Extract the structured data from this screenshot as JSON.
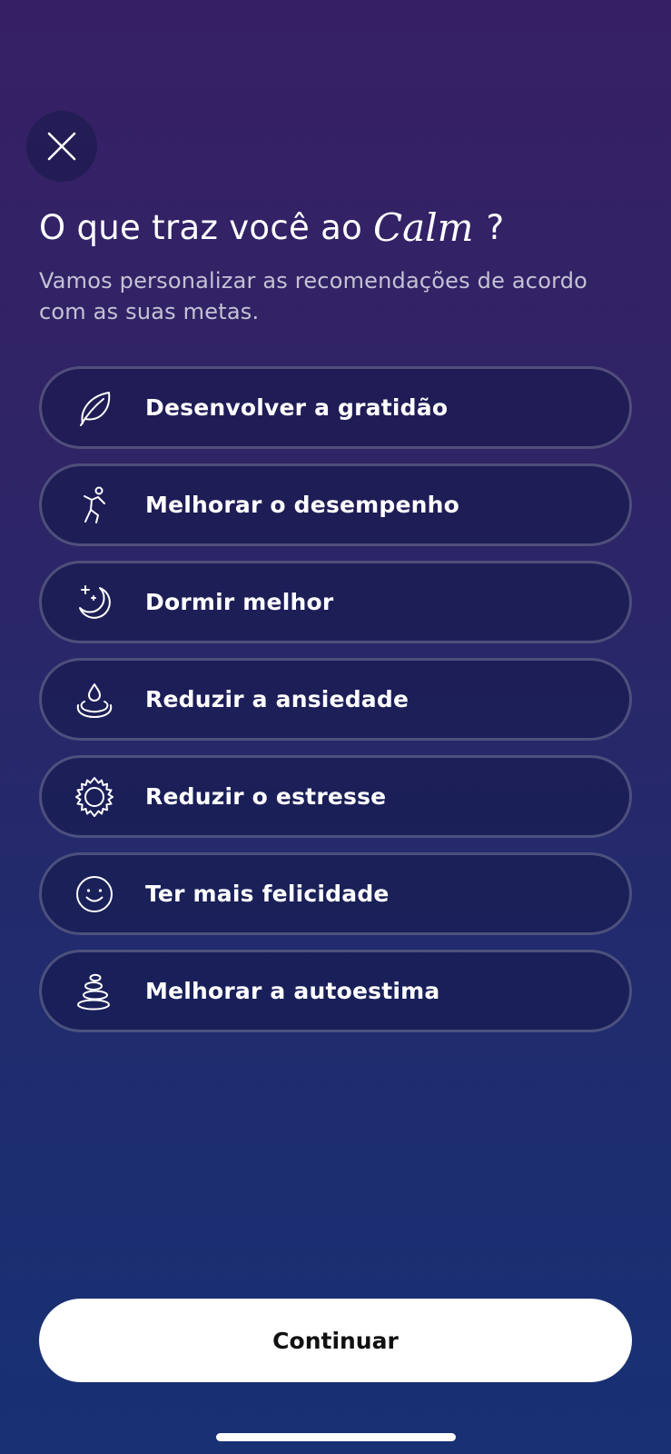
{
  "header": {
    "close_icon": "close-icon",
    "title_before": "O que traz você ao",
    "brand": "Calm",
    "title_after": "?",
    "subtitle": "Vamos personalizar as recomendações de acordo com as suas metas."
  },
  "goals": [
    {
      "label": "Desenvolver a gratidão",
      "icon": "leaf-icon"
    },
    {
      "label": "Melhorar o desempenho",
      "icon": "running-figure-icon"
    },
    {
      "label": "Dormir melhor",
      "icon": "moon-stars-icon"
    },
    {
      "label": "Reduzir a ansiedade",
      "icon": "water-drop-ripple-icon"
    },
    {
      "label": "Reduzir o estresse",
      "icon": "sun-icon"
    },
    {
      "label": "Ter mais felicidade",
      "icon": "smiley-icon"
    },
    {
      "label": "Melhorar a autoestima",
      "icon": "stacked-stones-icon"
    }
  ],
  "footer": {
    "continue_label": "Continuar"
  }
}
